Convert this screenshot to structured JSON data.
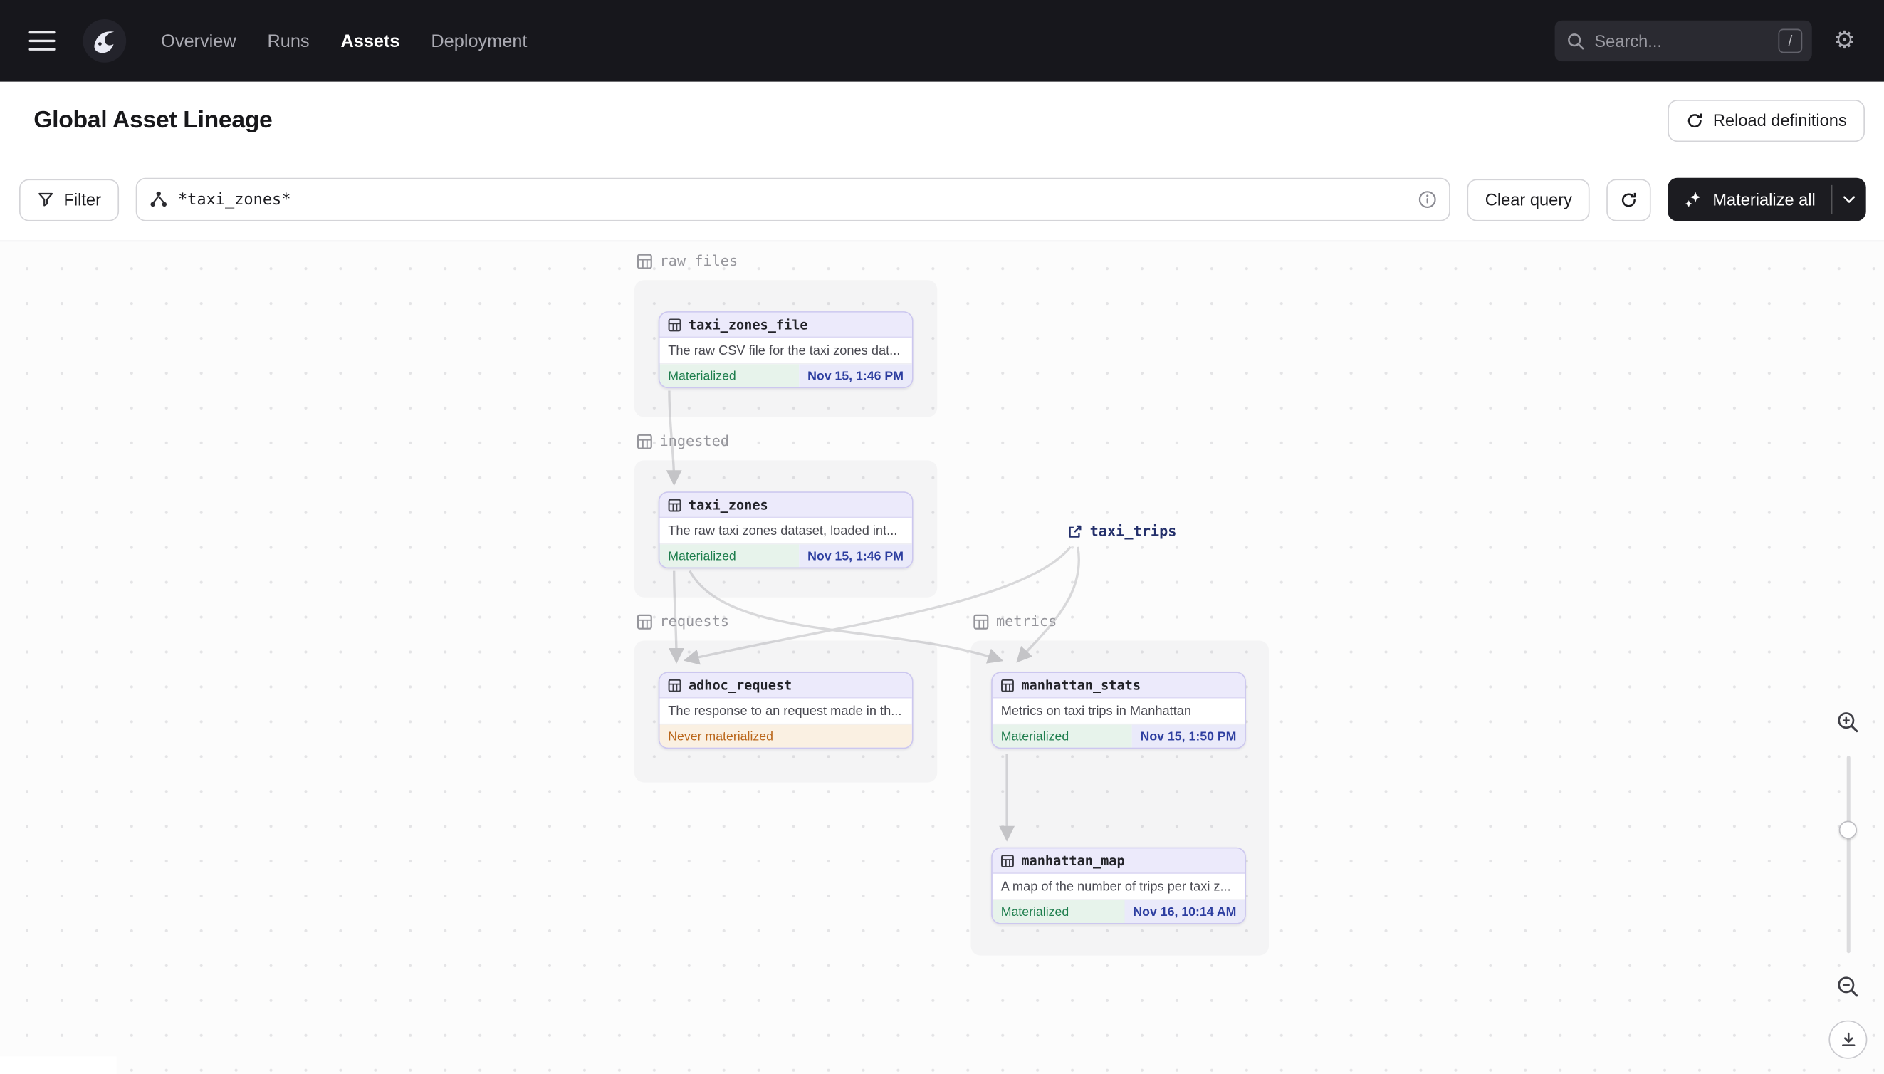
{
  "colors": {
    "navbar-bg": "#17171C",
    "materialized-text": "#1E7E4D",
    "materialized-bg": "#E7F3EB",
    "timestamp-text": "#2D3EA0",
    "timestamp-bg": "#EAEAFA",
    "never-text": "#BA661A",
    "never-bg": "#FAF0E2",
    "node-border": "#CCC7EF",
    "node-header-bg": "#ECEAFB",
    "external-text": "#24306B",
    "edge": "#D8D8DA"
  },
  "navbar": {
    "nav_items": [
      {
        "label": "Overview"
      },
      {
        "label": "Runs"
      },
      {
        "label": "Assets"
      },
      {
        "label": "Deployment"
      }
    ],
    "search_placeholder": "Search...",
    "search_shortcut": "/"
  },
  "header": {
    "title": "Global Asset Lineage",
    "reload_label": "Reload definitions"
  },
  "toolbar": {
    "filter_label": "Filter",
    "query_value": "*taxi_zones*",
    "clear_label": "Clear query",
    "materialize_label": "Materialize all"
  },
  "graph": {
    "groups": [
      {
        "name": "raw_files"
      },
      {
        "name": "ingested"
      },
      {
        "name": "requests"
      },
      {
        "name": "metrics"
      }
    ],
    "nodes": [
      {
        "name": "taxi_zones_file",
        "group": "raw_files",
        "description": "The raw CSV file for the taxi zones dat...",
        "status": "Materialized",
        "timestamp": "Nov 15, 1:46 PM"
      },
      {
        "name": "taxi_zones",
        "group": "ingested",
        "description": "The raw taxi zones dataset, loaded int...",
        "status": "Materialized",
        "timestamp": "Nov 15, 1:46 PM"
      },
      {
        "name": "adhoc_request",
        "group": "requests",
        "description": "The response to an request made in th...",
        "status": "Never materialized",
        "timestamp": ""
      },
      {
        "name": "manhattan_stats",
        "group": "metrics",
        "description": "Metrics on taxi trips in Manhattan",
        "status": "Materialized",
        "timestamp": "Nov 15, 1:50 PM"
      },
      {
        "name": "manhattan_map",
        "group": "metrics",
        "description": "A map of the number of trips per taxi z...",
        "status": "Materialized",
        "timestamp": "Nov 16, 10:14 AM"
      }
    ],
    "external": {
      "name": "taxi_trips"
    }
  }
}
